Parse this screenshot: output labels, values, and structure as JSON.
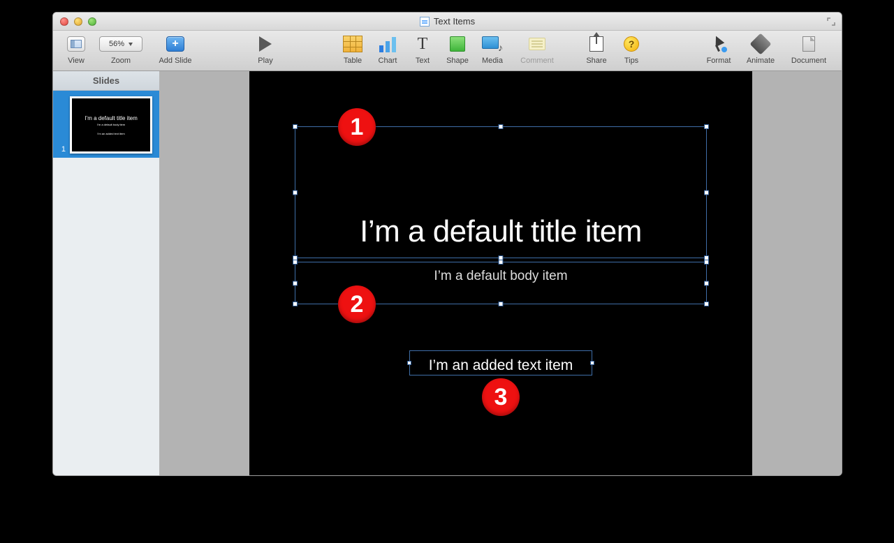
{
  "window": {
    "title": "Text Items"
  },
  "toolbar": {
    "view": "View",
    "zoom_label": "Zoom",
    "zoom_value": "56%",
    "add_slide": "Add Slide",
    "play": "Play",
    "table": "Table",
    "chart": "Chart",
    "text": "Text",
    "shape": "Shape",
    "media": "Media",
    "comment": "Comment",
    "share": "Share",
    "tips": "Tips",
    "format": "Format",
    "animate": "Animate",
    "document": "Document"
  },
  "sidebar": {
    "header": "Slides",
    "thumb_number": "1"
  },
  "slide": {
    "title": "I’m a default title item",
    "body": "I’m a default body item",
    "added": "I’m an added text item"
  },
  "callouts": {
    "one": "1",
    "two": "2",
    "three": "3"
  }
}
